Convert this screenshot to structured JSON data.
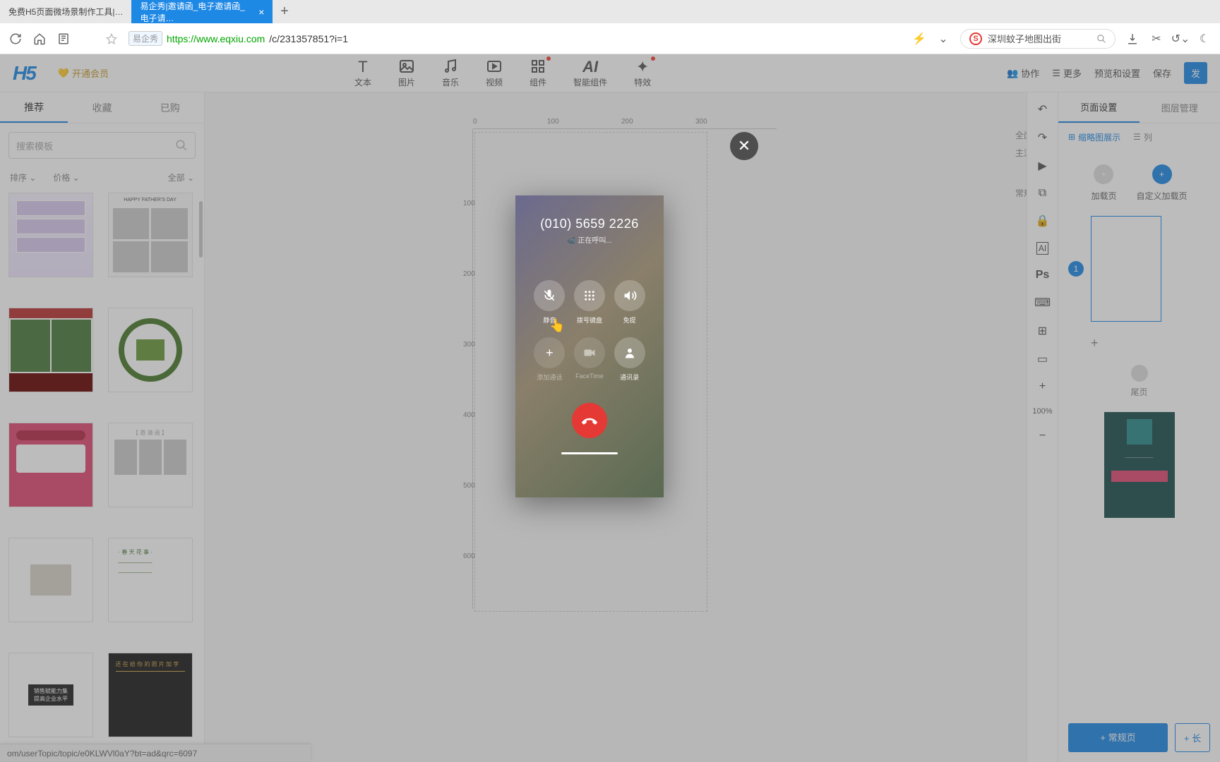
{
  "browser": {
    "tabs": [
      {
        "title": "免费H5页面微场景制作工具|…"
      },
      {
        "title": "易企秀|邀请函_电子邀请函_电子请…"
      }
    ],
    "siteName": "易企秀",
    "urlHost": "https://www.eqxiu.com",
    "urlPath": "/c/231357851?i=1",
    "searchPlaceholder": "深圳蚊子地图出街"
  },
  "app": {
    "logo": "H5",
    "vip": "开通会员",
    "tools": [
      {
        "key": "text",
        "label": "文本"
      },
      {
        "key": "image",
        "label": "图片"
      },
      {
        "key": "music",
        "label": "音乐"
      },
      {
        "key": "video",
        "label": "视频"
      },
      {
        "key": "component",
        "label": "组件",
        "dot": true
      },
      {
        "key": "ai",
        "label": "智能组件"
      },
      {
        "key": "effect",
        "label": "特效",
        "dot": true
      }
    ],
    "right": {
      "collab": "协作",
      "more": "更多",
      "preview": "预览和设置",
      "save": "保存",
      "publish": "发"
    }
  },
  "left": {
    "tabs": [
      "推荐",
      "收藏",
      "已购"
    ],
    "searchPlaceholder": "搜索模板",
    "filters": {
      "sort": "排序",
      "price": "价格",
      "all": "全部"
    }
  },
  "canvas": {
    "rulerH": [
      0,
      100,
      200,
      300
    ],
    "rulerV": [
      100,
      200,
      300,
      400,
      500,
      600
    ],
    "screenOpts": [
      "全面屏",
      "主流屏",
      "常规屏"
    ]
  },
  "call": {
    "number": "(010) 5659 2226",
    "status": "📹 正在呼叫...",
    "buttons": {
      "mute": "静音",
      "keypad": "拨号键盘",
      "speaker": "免提",
      "add": "添加通话",
      "facetime": "FaceTime",
      "contacts": "通讯录"
    }
  },
  "rail": {
    "zoom": "100%"
  },
  "right": {
    "tabs": [
      "页面设置",
      "图层管理"
    ],
    "view": {
      "thumb": "缩略图展示",
      "list": "列"
    },
    "addPages": {
      "load": "加载页",
      "custom": "自定义加载页"
    },
    "page1": "1",
    "endPage": "尾页",
    "addNormal": "+ 常规页",
    "addLong": "+ 长"
  },
  "status": "om/userTopic/topic/e0KLWVl0aY?bt=ad&qrc=6097"
}
